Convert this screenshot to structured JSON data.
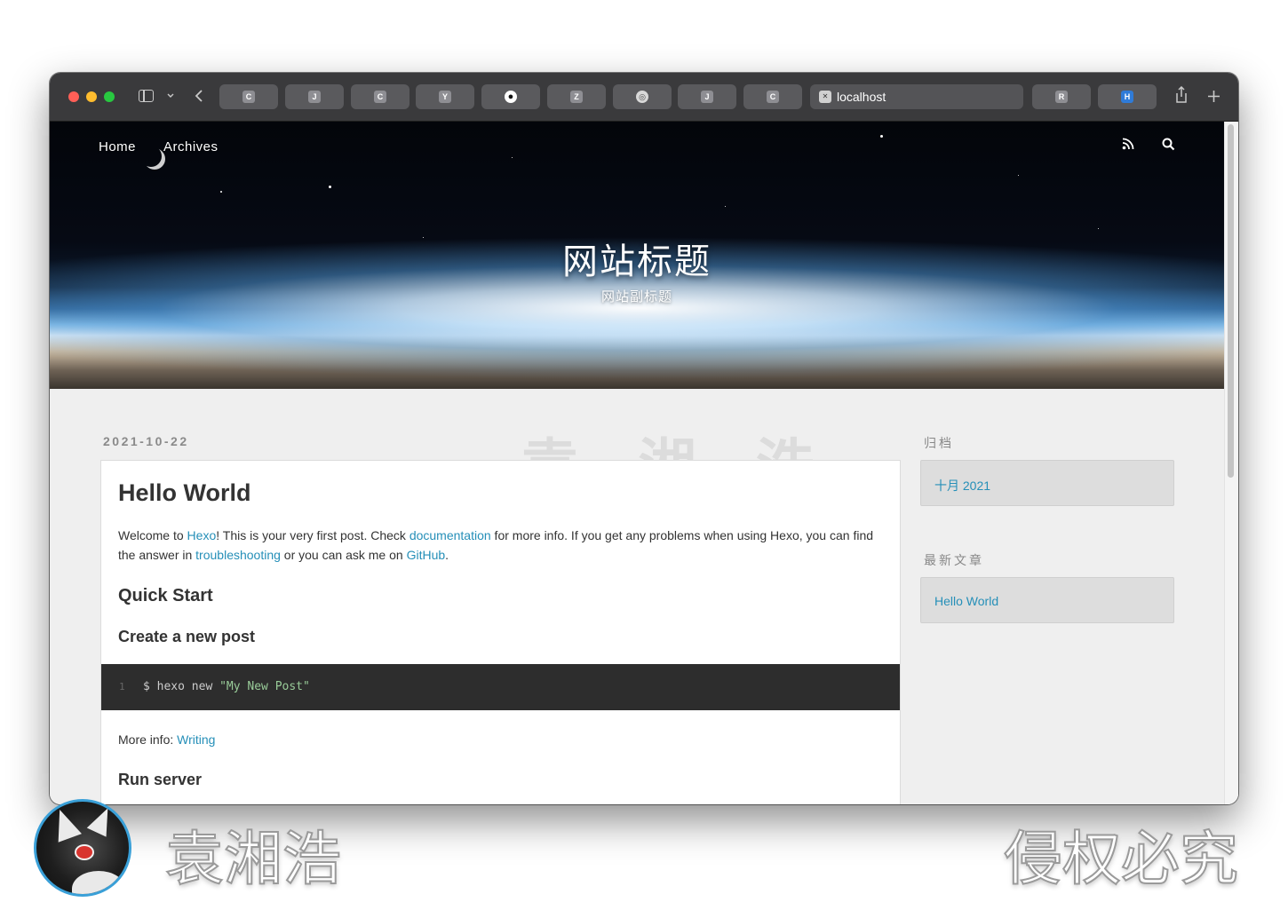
{
  "browser": {
    "tabs": [
      {
        "letter": "C",
        "icon": "c-favicon"
      },
      {
        "letter": "J",
        "icon": "j-favicon"
      },
      {
        "letter": "C",
        "icon": "c-favicon"
      },
      {
        "letter": "Y",
        "icon": "y-favicon"
      },
      {
        "letter": "",
        "icon": "github-favicon"
      },
      {
        "letter": "Z",
        "icon": "z-favicon"
      },
      {
        "letter": "",
        "icon": "globe-favicon"
      },
      {
        "letter": "J",
        "icon": "j-favicon"
      },
      {
        "letter": "C",
        "icon": "c-favicon"
      }
    ],
    "active_tab": {
      "url": "localhost",
      "icon": "x-favicon"
    },
    "right_tabs": [
      {
        "letter": "R",
        "icon": "r-favicon"
      },
      {
        "letter": "H",
        "icon": "h-favicon"
      }
    ],
    "icons": [
      "sidebar-toggle-icon",
      "chevron-down-icon",
      "back-icon",
      "share-icon",
      "new-tab-icon"
    ]
  },
  "site": {
    "nav": {
      "home": "Home",
      "archives": "Archives"
    },
    "title": "网站标题",
    "subtitle": "网站副标题",
    "header_icons": [
      "rss-icon",
      "search-icon"
    ]
  },
  "post": {
    "date": "2021-10-22",
    "title": "Hello World",
    "intro": {
      "t1": "Welcome to ",
      "hexo": "Hexo",
      "t2": "! This is your very first post. Check ",
      "documentation": "documentation",
      "t3": " for more info. If you get any problems when using Hexo, you can find the answer in ",
      "troubleshooting": "troubleshooting",
      "t4": " or you can ask me on ",
      "github": "GitHub",
      "t5": "."
    },
    "quick_start": "Quick Start",
    "create_post": "Create a new post",
    "code": {
      "line": "1",
      "cmd": "$ hexo new ",
      "arg": "\"My New Post\""
    },
    "more_info_label": "More info: ",
    "more_info_link": "Writing",
    "run_server": "Run server"
  },
  "sidebar": {
    "archive_title": "归档",
    "archive_item": "十月 2021",
    "recent_title": "最新文章",
    "recent_item": "Hello World"
  },
  "overlay": {
    "watermark_center": "袁 湘 浩",
    "author": "袁湘浩",
    "copyright": "侵权必究"
  },
  "colors": {
    "link": "#258fb8",
    "toolbar": "#3a3a3c",
    "page_bg": "#efefef"
  }
}
